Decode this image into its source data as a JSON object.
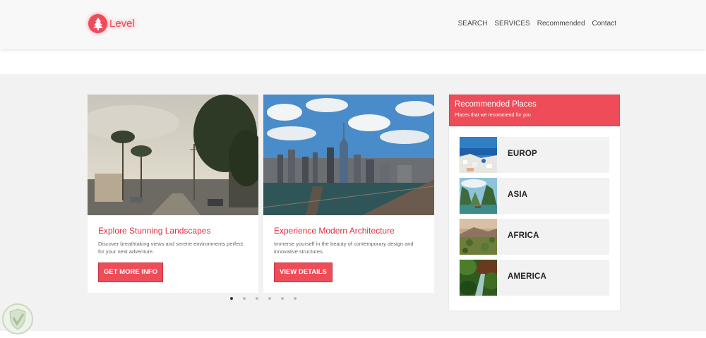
{
  "header": {
    "logo_text": "Level",
    "nav": [
      "SEARCH",
      "SERVICES",
      "Recommended",
      "Contact"
    ]
  },
  "cards": [
    {
      "title": "Explore Stunning Landscapes",
      "description": "Discover breathtaking views and serene environments perfect for your next adventure.",
      "button": "GET MORE INFO",
      "image": "palm-street-photo"
    },
    {
      "title": "Experience Modern Architecture",
      "description": "Immerse yourself in the beauty of contemporary design and innovative structures.",
      "button": "VIEW DETAILS",
      "image": "city-skyline-photo"
    }
  ],
  "carousel": {
    "dots": 6,
    "active": 1
  },
  "sidebar": {
    "title": "Recommended Places",
    "subtitle": "Places that we recommend for you",
    "places": [
      {
        "label": "EUROP",
        "image": "santorini-photo"
      },
      {
        "label": "ASIA",
        "image": "halong-bay-photo"
      },
      {
        "label": "AFRICA",
        "image": "savanna-photo"
      },
      {
        "label": "AMERICA",
        "image": "jungle-waterfall-photo"
      }
    ]
  },
  "colors": {
    "accent": "#ee4c58",
    "title_red": "#e0303e",
    "band": "#f2f2f2"
  }
}
